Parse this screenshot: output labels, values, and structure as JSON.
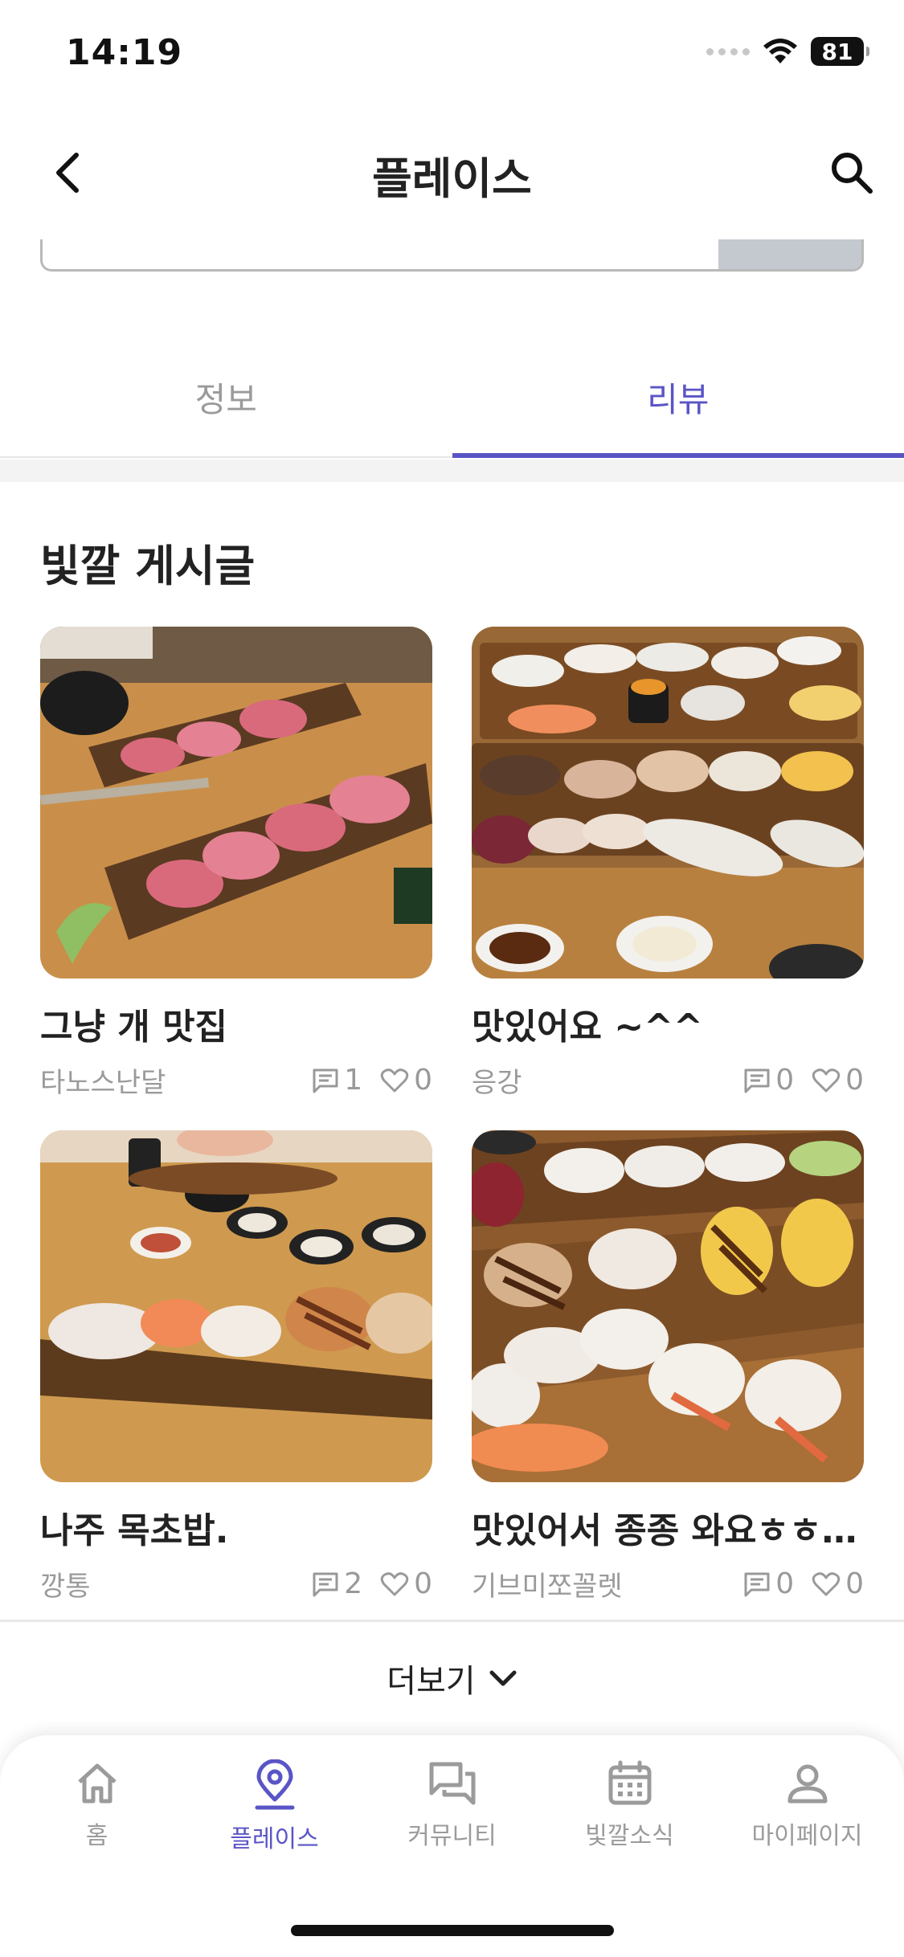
{
  "status_bar": {
    "time": "14:19",
    "battery": "81",
    "icons": [
      "signal-dots",
      "wifi-icon",
      "battery-icon"
    ]
  },
  "header": {
    "title": "플레이스",
    "back_icon": "chevron-left-icon",
    "search_icon": "search-icon"
  },
  "tabs": [
    {
      "label": "정보",
      "active": false
    },
    {
      "label": "리뷰",
      "active": true
    }
  ],
  "section": {
    "title": "빛깔 게시글"
  },
  "posts": [
    {
      "title": "그냥 개 맛집",
      "author": "타노스난달",
      "comments": "1",
      "likes": "0"
    },
    {
      "title": "맛있어요 ~^^",
      "author": "응강",
      "comments": "0",
      "likes": "0"
    },
    {
      "title": "나주 목초밥.",
      "author": "깡통",
      "comments": "2",
      "likes": "0"
    },
    {
      "title": "맛있어서 종종 와요ㅎㅎ ...",
      "author": "기브미쪼꼴렛",
      "comments": "0",
      "likes": "0"
    }
  ],
  "more": {
    "label": "더보기",
    "icon": "chevron-down-icon"
  },
  "bottom_nav": [
    {
      "label": "홈",
      "icon": "home-icon",
      "active": false
    },
    {
      "label": "플레이스",
      "icon": "location-pin-icon",
      "active": true
    },
    {
      "label": "커뮤니티",
      "icon": "chat-bubbles-icon",
      "active": false
    },
    {
      "label": "빛깔소식",
      "icon": "calendar-icon",
      "active": false
    },
    {
      "label": "마이페이지",
      "icon": "user-icon",
      "active": false
    }
  ],
  "colors": {
    "accent": "#5a55c6",
    "muted": "#9a9a9a",
    "text": "#222222"
  }
}
